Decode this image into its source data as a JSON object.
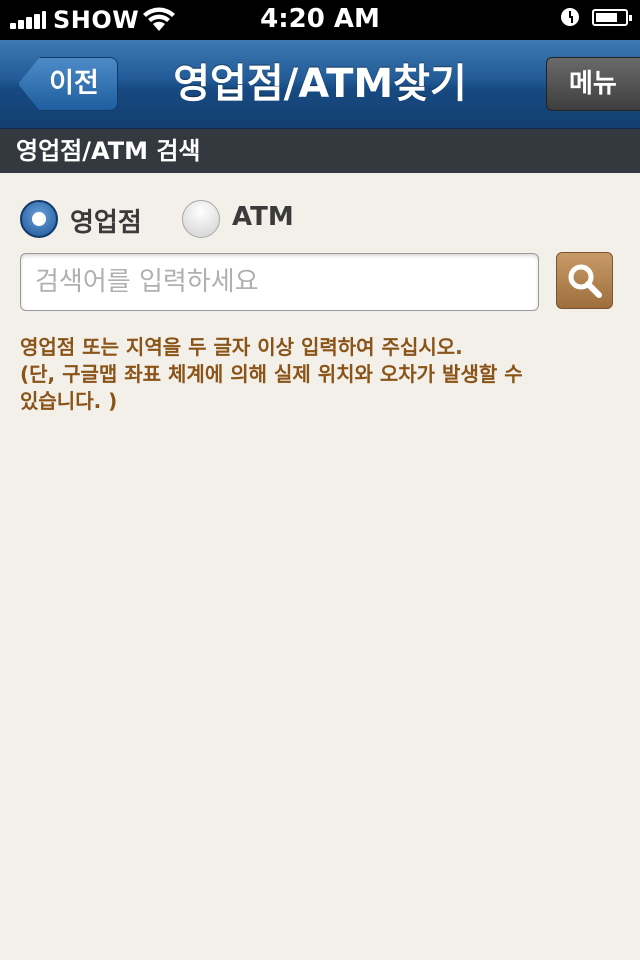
{
  "status_bar": {
    "carrier": "SHOW",
    "time": "4:20 AM",
    "battery_level": 0.75
  },
  "nav": {
    "back_label": "이전",
    "title": "영업점/ATM찾기",
    "menu_label": "메뉴"
  },
  "section": {
    "title": "영업점/ATM 검색"
  },
  "search_type": {
    "options": [
      "영업점",
      "ATM"
    ],
    "selected": "영업점"
  },
  "search": {
    "placeholder": "검색어를 입력하세요",
    "value": "",
    "button_icon": "magnifier-icon"
  },
  "notice": {
    "lines": [
      "영업점 또는 지역을 두 글자 이상 입력하여 주십시오.",
      "(단, 구글맵 좌표 체계에 의해 실제 위치와 오차가 발생할 수",
      "있습니다. )"
    ]
  },
  "colors": {
    "nav_blue": "#225b97",
    "section_bg": "#34383f",
    "page_bg": "#f3efe9",
    "notice_text": "#8a5418",
    "search_button": "#b6864f"
  }
}
